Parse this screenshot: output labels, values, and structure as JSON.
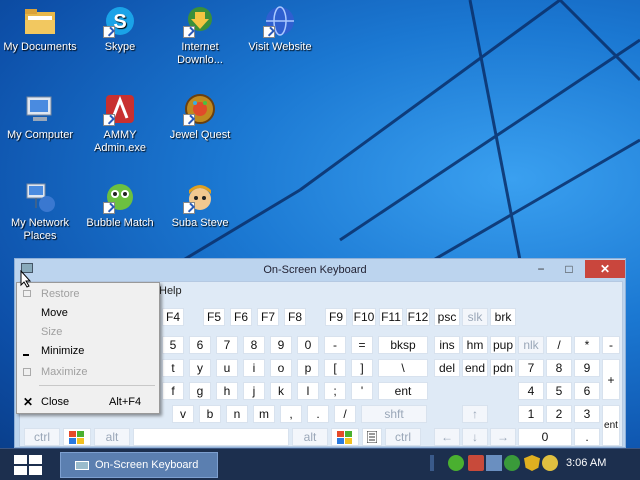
{
  "desktop": {
    "icons": [
      {
        "label": "My Documents",
        "icon": "folder-icon"
      },
      {
        "label": "Skype",
        "icon": "skype-icon"
      },
      {
        "label": "Internet Downlo...",
        "icon": "idm-icon"
      },
      {
        "label": "Visit Website",
        "icon": "globe-icon"
      },
      {
        "label": "My Computer",
        "icon": "computer-icon"
      },
      {
        "label": "AMMY Admin.exe",
        "icon": "ammy-icon"
      },
      {
        "label": "Jewel Quest",
        "icon": "jewel-quest-icon"
      },
      {
        "label": "My Network Places",
        "icon": "network-icon"
      },
      {
        "label": "Bubble Match",
        "icon": "bubble-match-icon"
      },
      {
        "label": "Suba Steve",
        "icon": "suba-steve-icon"
      }
    ]
  },
  "osk": {
    "title": "On-Screen Keyboard",
    "menu_visible": "Help",
    "controls": {
      "minimize": "−",
      "maximize": "□",
      "close": "✕"
    },
    "keys": {
      "r0": [
        "F4",
        "F5",
        "F6",
        "F7",
        "F8",
        "F9",
        "F10",
        "F11",
        "F12",
        "psc",
        "slk",
        "brk"
      ],
      "r1": [
        "5",
        "6",
        "7",
        "8",
        "9",
        "0",
        "-",
        "=",
        "bksp",
        "ins",
        "hm",
        "pup",
        "nlk",
        "/",
        "*",
        "-"
      ],
      "r2": [
        "t",
        "y",
        "u",
        "i",
        "o",
        "p",
        "[",
        "]",
        "\\",
        "del",
        "end",
        "pdn",
        "7",
        "8",
        "9",
        "+"
      ],
      "r3": [
        "f",
        "g",
        "h",
        "j",
        "k",
        "l",
        ";",
        "'",
        "ent",
        "4",
        "5",
        "6"
      ],
      "r4": [
        "v",
        "b",
        "n",
        "m",
        ",",
        ".",
        "/",
        "shft",
        "1",
        "2",
        "3",
        "ent"
      ],
      "r5": [
        "ctrl",
        "alt",
        "alt",
        "ctrl",
        "0",
        "."
      ],
      "arrows": [
        "↑",
        "←",
        "↓",
        "→"
      ]
    }
  },
  "context_menu": {
    "items": [
      {
        "label": "Restore",
        "shortcut": "",
        "disabled": true
      },
      {
        "label": "Move",
        "shortcut": "",
        "disabled": false
      },
      {
        "label": "Size",
        "shortcut": "",
        "disabled": true
      },
      {
        "label": "Minimize",
        "shortcut": "",
        "disabled": false
      },
      {
        "label": "Maximize",
        "shortcut": "",
        "disabled": true
      },
      {
        "label": "Close",
        "shortcut": "Alt+F4",
        "disabled": false
      }
    ]
  },
  "taskbar": {
    "button_label": "On-Screen Keyboard",
    "clock": "3:06 AM"
  },
  "colors": {
    "accent": "#1b78d2",
    "close": "#c9463d",
    "taskbar": "#1c2f4e"
  }
}
